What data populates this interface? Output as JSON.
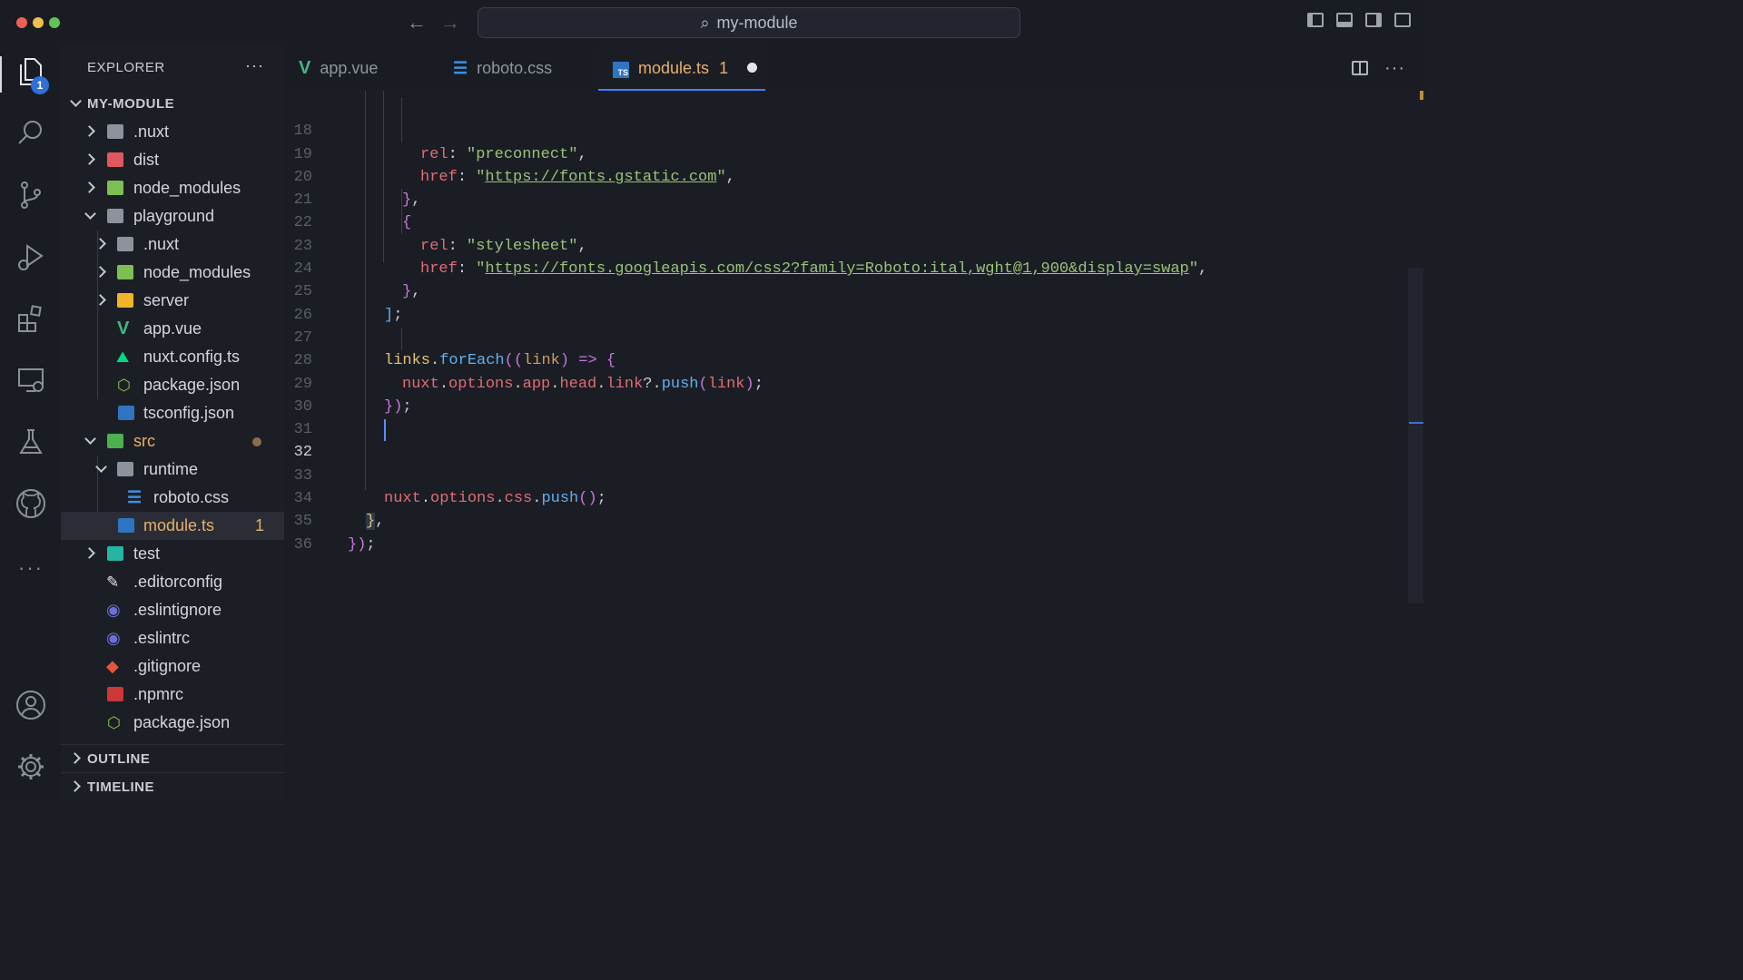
{
  "window": {
    "title": "my-module"
  },
  "activity_bar": {
    "explorer_badge": "1"
  },
  "sidebar": {
    "title": "EXPLORER",
    "more": "···",
    "root": "MY-MODULE",
    "items": [
      {
        "label": ".nuxt"
      },
      {
        "label": "dist"
      },
      {
        "label": "node_modules"
      },
      {
        "label": "playground"
      },
      {
        "label": ".nuxt"
      },
      {
        "label": "node_modules"
      },
      {
        "label": "server"
      },
      {
        "label": "app.vue"
      },
      {
        "label": "nuxt.config.ts"
      },
      {
        "label": "package.json"
      },
      {
        "label": "tsconfig.json"
      },
      {
        "label": "src"
      },
      {
        "label": "runtime"
      },
      {
        "label": "roboto.css"
      },
      {
        "label": "module.ts",
        "badge": "1"
      },
      {
        "label": "test"
      },
      {
        "label": ".editorconfig"
      },
      {
        "label": ".eslintignore"
      },
      {
        "label": ".eslintrc"
      },
      {
        "label": ".gitignore"
      },
      {
        "label": ".npmrc"
      },
      {
        "label": "package.json"
      }
    ],
    "outline": "OUTLINE",
    "timeline": "TIMELINE"
  },
  "tabs": [
    {
      "label": "app.vue"
    },
    {
      "label": "roboto.css"
    },
    {
      "label": "module.ts",
      "badge": "1"
    }
  ],
  "editor": {
    "line_numbers": [
      "18",
      "19",
      "20",
      "21",
      "22",
      "23",
      "24",
      "25",
      "26",
      "27",
      "28",
      "29",
      "30",
      "31",
      "32",
      "33",
      "34",
      "35",
      "36"
    ],
    "current_line": "32",
    "tokens": {
      "rel": "rel",
      "href": "href",
      "preconnect": "\"preconnect\"",
      "gstatic": "https://fonts.gstatic.com",
      "stylesheet": "\"stylesheet\"",
      "googleapis": "https://fonts.googleapis.com/css2?family=Roboto:ital,wght@1,900&display=swap",
      "links": "links",
      "forEach": "forEach",
      "link": "link",
      "nuxt": "nuxt",
      "options": "options",
      "app": "app",
      "head": "head",
      "push": "push",
      "css": "css"
    }
  },
  "colors": {
    "accent": "#3a86ff",
    "active_tab_text": "#e8b06a",
    "badge": "#2f6fd8"
  }
}
